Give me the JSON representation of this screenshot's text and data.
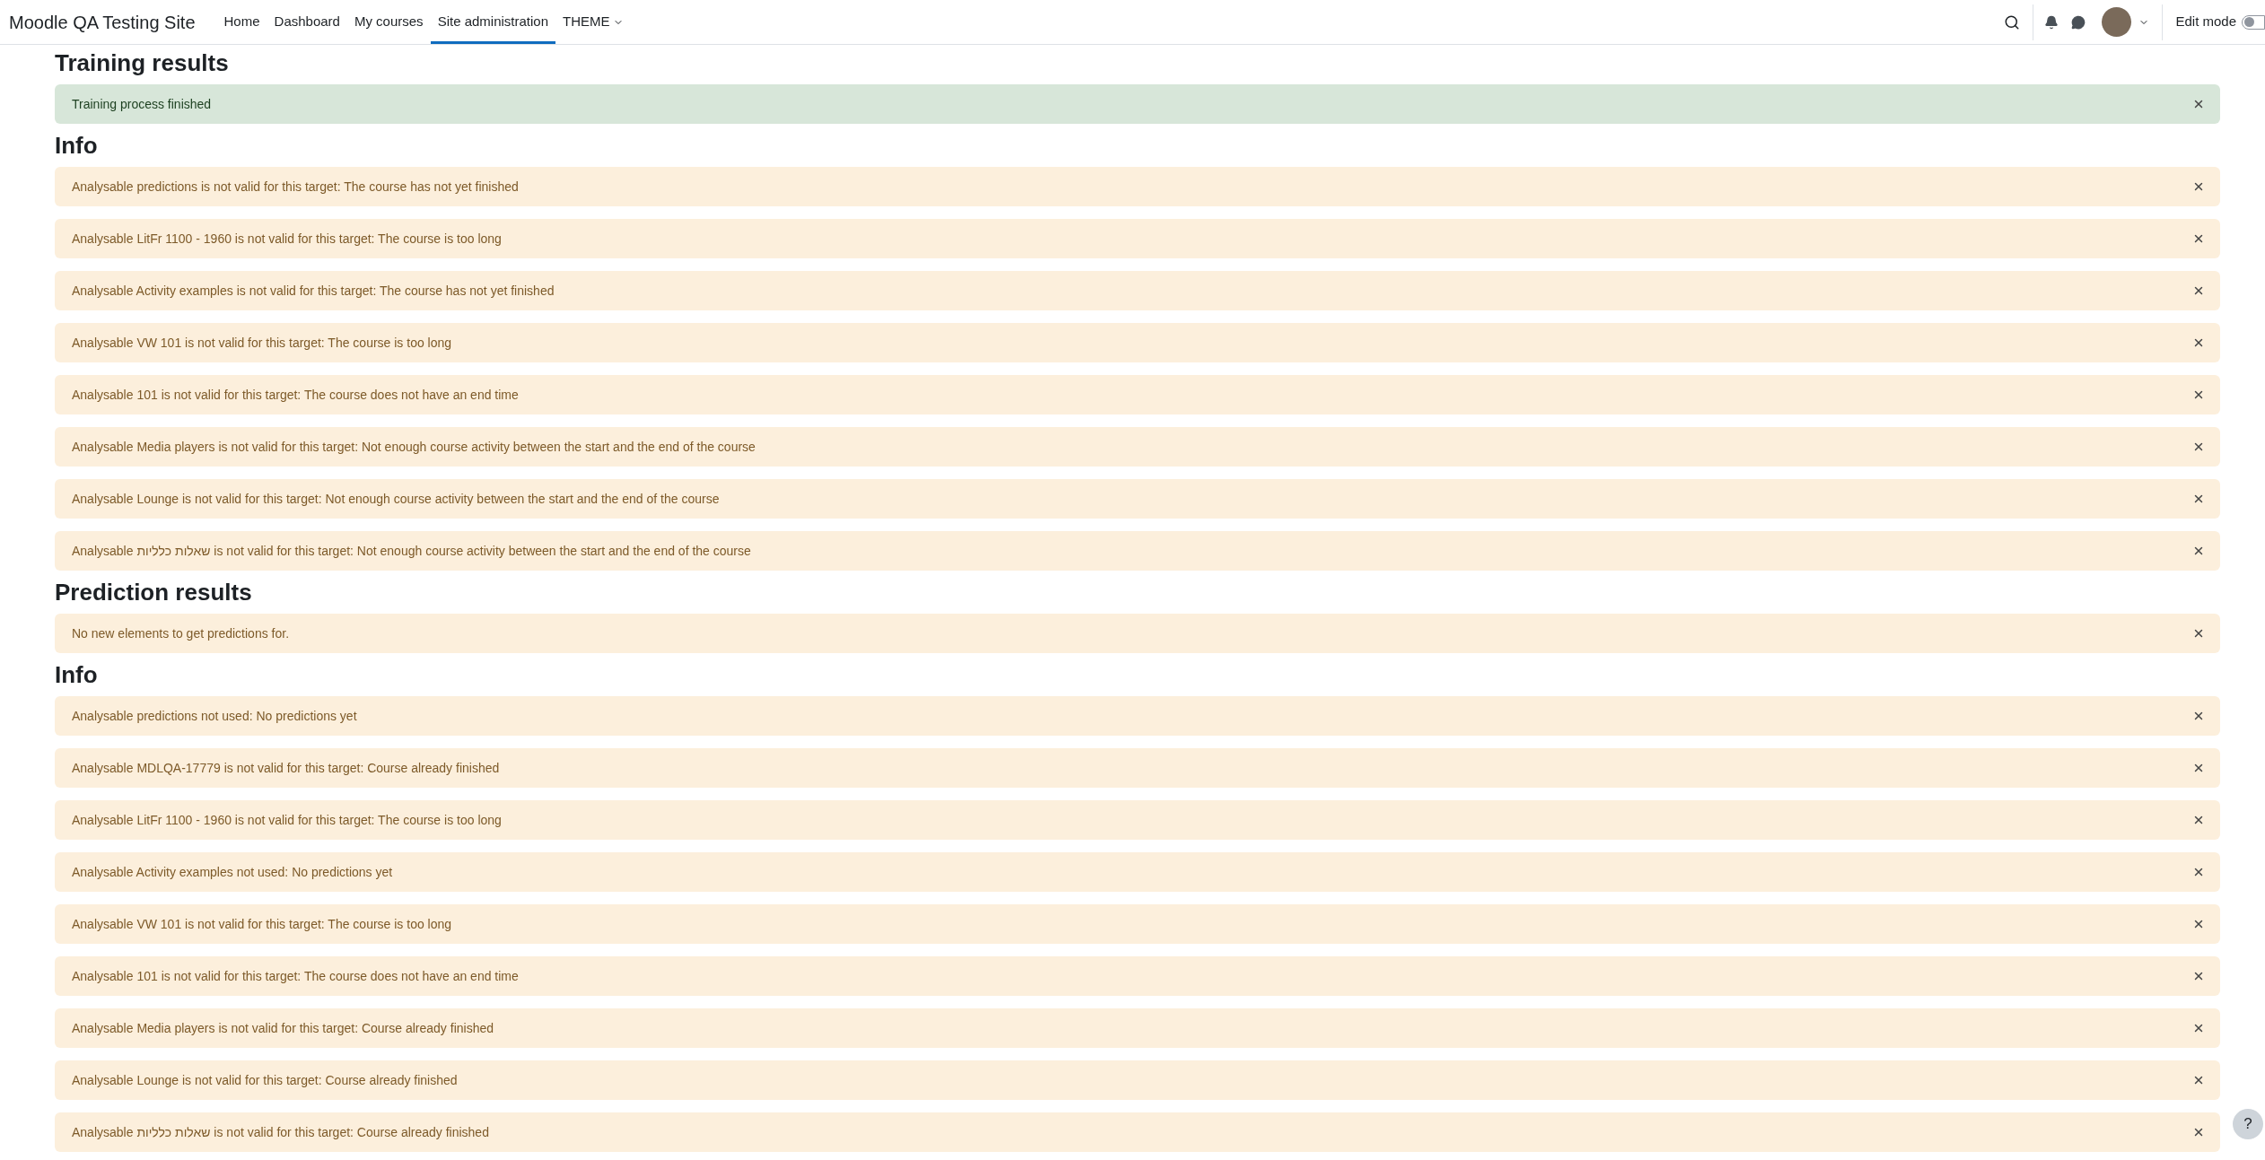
{
  "navbar": {
    "brand": "Moodle QA Testing Site",
    "links": [
      {
        "label": "Home",
        "kind": "link",
        "selected": false
      },
      {
        "label": "Dashboard",
        "kind": "link",
        "selected": false
      },
      {
        "label": "My courses",
        "kind": "link",
        "selected": false
      },
      {
        "label": "Site administration",
        "kind": "link",
        "selected": true
      },
      {
        "label": "THEME",
        "kind": "dropdown",
        "selected": false
      }
    ],
    "edit_mode": {
      "label": "Edit mode",
      "on": false
    }
  },
  "sections": [
    {
      "title": "Training results",
      "alerts": [
        {
          "text": "Training process finished",
          "kind": "success"
        }
      ]
    },
    {
      "title": "Info",
      "alerts": [
        {
          "text": "Analysable predictions is not valid for this target: The course has not yet finished",
          "kind": "warning"
        },
        {
          "text": "Analysable LitFr 1100 - 1960 is not valid for this target: The course is too long",
          "kind": "warning"
        },
        {
          "text": "Analysable Activity examples is not valid for this target: The course has not yet finished",
          "kind": "warning"
        },
        {
          "text": "Analysable VW 101 is not valid for this target: The course is too long",
          "kind": "warning"
        },
        {
          "text": "Analysable 101 is not valid for this target: The course does not have an end time",
          "kind": "warning"
        },
        {
          "text": "Analysable Media players is not valid for this target: Not enough course activity between the start and the end of the course",
          "kind": "warning"
        },
        {
          "text": "Analysable Lounge is not valid for this target: Not enough course activity between the start and the end of the course",
          "kind": "warning"
        },
        {
          "text": "Analysable שאלות כלליות is not valid for this target: Not enough course activity between the start and the end of the course",
          "kind": "warning"
        }
      ]
    },
    {
      "title": "Prediction results",
      "alerts": [
        {
          "text": "No new elements to get predictions for.",
          "kind": "warning"
        }
      ]
    },
    {
      "title": "Info",
      "alerts": [
        {
          "text": "Analysable predictions not used: No predictions yet",
          "kind": "warning"
        },
        {
          "text": "Analysable MDLQA-17779 is not valid for this target: Course already finished",
          "kind": "warning"
        },
        {
          "text": "Analysable LitFr 1100 - 1960 is not valid for this target: The course is too long",
          "kind": "warning"
        },
        {
          "text": "Analysable Activity examples not used: No predictions yet",
          "kind": "warning"
        },
        {
          "text": "Analysable VW 101 is not valid for this target: The course is too long",
          "kind": "warning"
        },
        {
          "text": "Analysable 101 is not valid for this target: The course does not have an end time",
          "kind": "warning"
        },
        {
          "text": "Analysable Media players is not valid for this target: Course already finished",
          "kind": "warning"
        },
        {
          "text": "Analysable Lounge is not valid for this target: Course already finished",
          "kind": "warning"
        },
        {
          "text": "Analysable שאלות כלליות is not valid for this target: Course already finished",
          "kind": "warning"
        }
      ]
    }
  ],
  "help_button": "?"
}
